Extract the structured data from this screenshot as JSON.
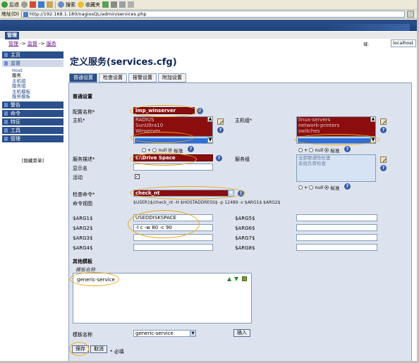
{
  "browser": {
    "back_label": "后退",
    "search_label": "搜索",
    "favorites_label": "收藏夹",
    "address_label": "地址(D)",
    "url": "http://192.168.1.180/nagiosQL/admin/services.php"
  },
  "topnav": {
    "active_tab": "管理"
  },
  "breadcrumb": {
    "item1": "管理",
    "arrow1": " -> ",
    "item2": "监督",
    "arrow2": " -> ",
    "item3": "服务"
  },
  "domain": {
    "label": "域:",
    "value": "localhost"
  },
  "sidebar": {
    "main": "主页",
    "supervise": "监督",
    "supervise_items": [
      "Host",
      "服务",
      "主机组",
      "服务组",
      "主机模板",
      "服务模板"
    ],
    "alarm": "警告",
    "commands": "命令",
    "special": "特征",
    "tools": "工具",
    "admin": "管理",
    "hide_menu": "[隐藏菜单]"
  },
  "page_title": "定义服务(services.cfg)",
  "tabs": [
    "普通设置",
    "检查设置",
    "报警设置",
    "附加设置"
  ],
  "form": {
    "section_general": "普通设置",
    "config_name_label": "配置名称*",
    "config_name_value": "imp_winserver",
    "host_label": "主机*",
    "host_options": [
      "RADIUS",
      "SunUltra10",
      "Winserver"
    ],
    "hostgroup_label": "主机组*",
    "hostgroup_options": [
      "linux-servers",
      "network-printers",
      "switches"
    ],
    "radio_plus": "+",
    "radio_null": "null",
    "radio_std": "标准",
    "service_desc_label": "服务描述*",
    "service_desc_value": "c:\\Drive Space",
    "servicegroup_label": "服务组",
    "servicegroup_options": [
      "全部联通性检查",
      "系统负荷检查"
    ],
    "display_name_label": "显示名",
    "active_label": "活动",
    "active_checked": "✓",
    "check_cmd_label": "检查命令*",
    "check_cmd_value": "check_nt",
    "cmd_view_label": "命令视图",
    "cmd_view_value": "$USER1$/check_nt -H $HOSTADDRESS$ -p 12489 -v $ARG1$ $ARG2$",
    "args_left": [
      {
        "label": "$ARG1$",
        "value": "USEDDISKSPACE"
      },
      {
        "label": "$ARG2$",
        "value": "-l c -w 80 -c 90"
      },
      {
        "label": "$ARG3$",
        "value": ""
      },
      {
        "label": "$ARG4$",
        "value": ""
      }
    ],
    "args_right": [
      {
        "label": "$ARG5$",
        "value": ""
      },
      {
        "label": "$ARG6$",
        "value": ""
      },
      {
        "label": "$ARG7$",
        "value": ""
      },
      {
        "label": "$ARG8$",
        "value": ""
      }
    ],
    "section_templates": "其他模板",
    "template_name_header": "模板名称",
    "template_list": [
      "generic-service"
    ],
    "template_name_label": "模板名称",
    "template_select_value": "generic-service",
    "insert_button": "插入",
    "save_button": "保存",
    "cancel_button": "取消",
    "required_note": "* 必填"
  },
  "colors": {
    "banner": "#2a4f8a",
    "selected_field": "#8b0d0d",
    "panel": "#dde3ee",
    "highlight": "#f0a818"
  }
}
